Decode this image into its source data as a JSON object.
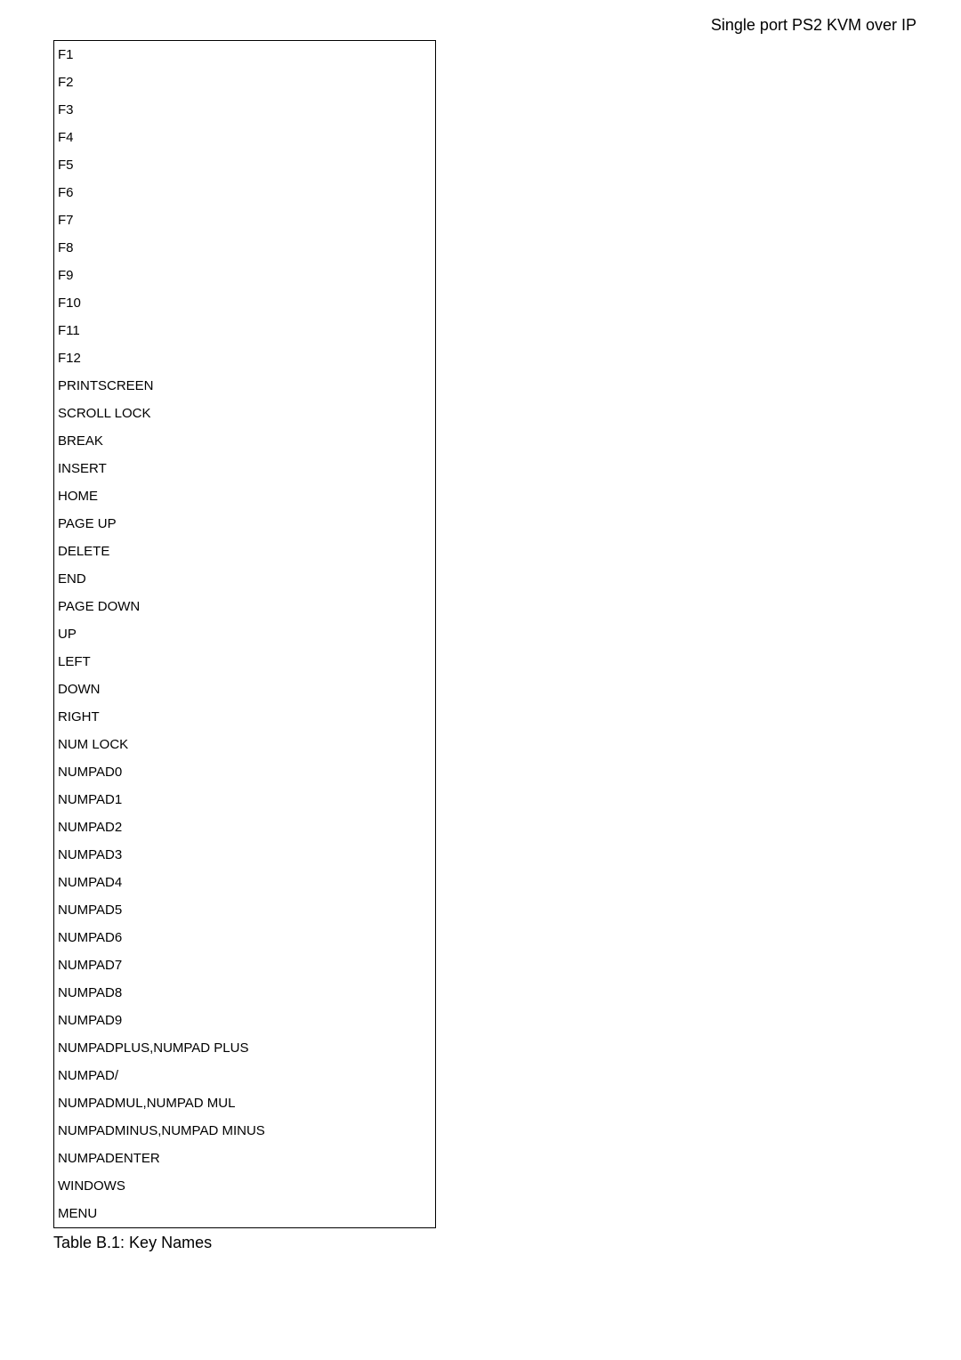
{
  "header": "Single port PS2 KVM over IP",
  "keys": [
    "F1",
    "F2",
    "F3",
    "F4",
    "F5",
    "F6",
    "F7",
    "F8",
    "F9",
    "F10",
    "F11",
    "F12",
    "PRINTSCREEN",
    "SCROLL LOCK",
    "BREAK",
    "INSERT",
    "HOME",
    "PAGE UP",
    "DELETE",
    "END",
    "PAGE DOWN",
    "UP",
    "LEFT",
    "DOWN",
    "RIGHT",
    "NUM LOCK",
    "NUMPAD0",
    "NUMPAD1",
    "NUMPAD2",
    "NUMPAD3",
    "NUMPAD4",
    "NUMPAD5",
    "NUMPAD6",
    "NUMPAD7",
    "NUMPAD8",
    "NUMPAD9",
    "NUMPADPLUS,NUMPAD PLUS",
    "NUMPAD/",
    "NUMPADMUL,NUMPAD MUL",
    "NUMPADMINUS,NUMPAD MINUS",
    "NUMPADENTER",
    "WINDOWS",
    "MENU"
  ],
  "caption": "Table B.1: Key Names"
}
